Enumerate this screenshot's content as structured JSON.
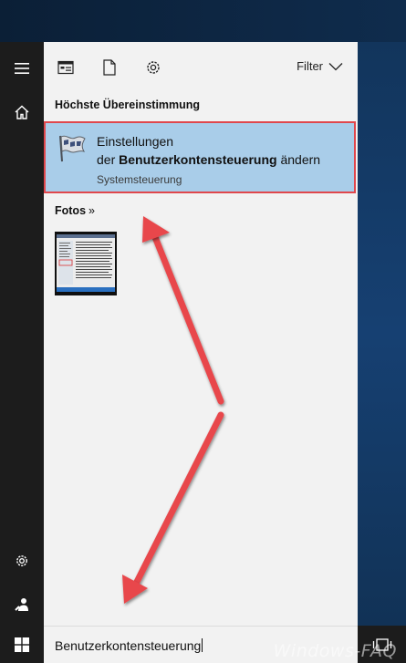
{
  "panel": {
    "filter_label": "Filter",
    "best_match_heading": "Höchste Übereinstimmung",
    "best_match": {
      "title_line1": "Einstellungen",
      "title_line2_prefix": "der ",
      "title_line2_bold": "Benutzerkontensteuerung",
      "title_line2_suffix": " ändern",
      "subtitle": "Systemsteuerung"
    },
    "photos_heading": "Fotos",
    "photos_chevron": "»"
  },
  "search": {
    "value": "Benutzerkontensteuerung"
  },
  "watermark": "Windows-FAQ",
  "colors": {
    "highlight": "#a9cde9",
    "highlight_border": "#e0474c",
    "annotation_arrow": "#e8474b",
    "rail": "#1c1c1c",
    "panel": "#f2f2f2"
  },
  "icons": {
    "rail": [
      "hamburger-icon",
      "home-icon",
      "settings-icon",
      "user-icon"
    ],
    "toolbar": [
      "apps-icon",
      "document-icon",
      "settings-icon"
    ],
    "taskbar": [
      "windows-logo-icon",
      "task-view-icon"
    ],
    "best_match": "uac-flag-icon"
  }
}
